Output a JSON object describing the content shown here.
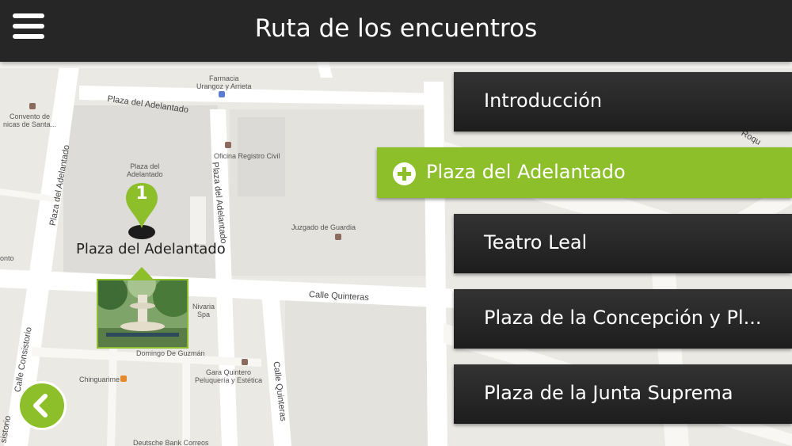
{
  "header": {
    "title": "Ruta de los encuentros",
    "menu_icon": "hamburger-menu-icon"
  },
  "map": {
    "marker": {
      "number": "1",
      "label": "Plaza del Adelantado"
    },
    "street_labels": {
      "plaza_adelantado_top": "Plaza del Adelantado",
      "plaza_adelantado_left": "Plaza del Adelantado",
      "plaza_adelantado_right": "Plaza del Adelantado",
      "calle_quinteras_h": "Calle Quinteras",
      "calle_quinteras_v": "Calle Quinteras",
      "calle_consistorio": "Calle Consistorio",
      "consistorio_short": "sistorio",
      "roque": "Roqu"
    },
    "places": {
      "farmacia": "Farmacia\nUrangoz y Arrieta",
      "convento": "Convento de\nnicas de Santa...",
      "plaza_block": "Plaza del\nAdelantado",
      "registro": "Oficina Registro Civil",
      "juzgado": "Juzgado de Guardia",
      "nivaria": "Nivaria\nSpa",
      "domingo": "Domingo De Guzmán",
      "gara": "Gara Quintero\nPeluquería y Estética",
      "chinguarime": "Chinguarime",
      "deutsche": "Deutsche Bank Correos",
      "onto": "onto"
    }
  },
  "menu": {
    "items": [
      {
        "label": "Introducción",
        "active": false
      },
      {
        "label": "Plaza del Adelantado",
        "active": true
      },
      {
        "label": "Teatro Leal",
        "active": false
      },
      {
        "label": "Plaza de la Concepción y Pl...",
        "active": false
      },
      {
        "label": "Plaza de la Junta Suprema",
        "active": false
      }
    ]
  },
  "back_button": {
    "icon": "chevron-left-icon"
  },
  "colors": {
    "accent": "#8cbf2a",
    "header_bg": "#262626",
    "menu_bg": "#262626",
    "map_bg": "#ebe9e4"
  }
}
